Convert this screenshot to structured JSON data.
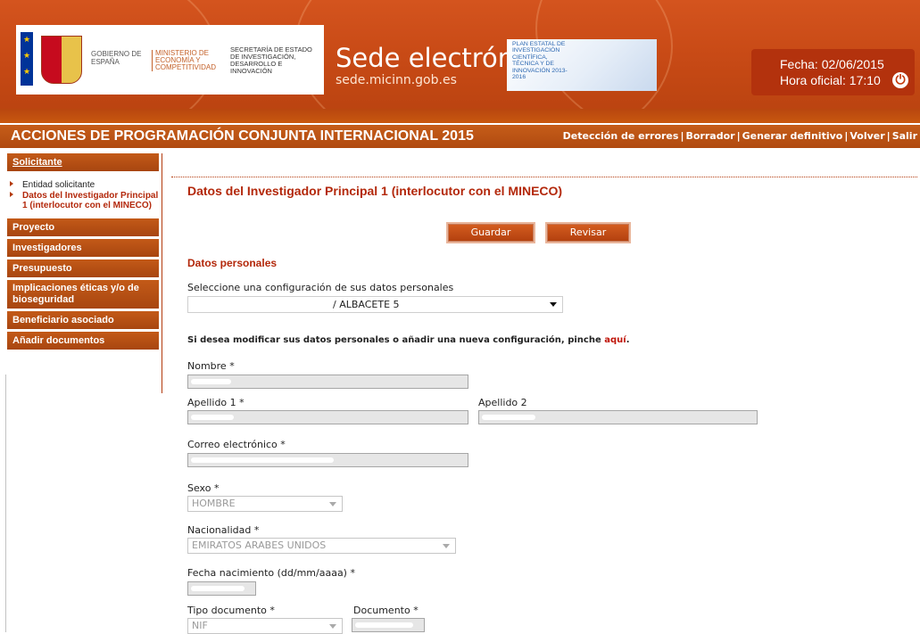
{
  "header": {
    "gobierno": "GOBIERNO DE ESPAÑA",
    "ministerio": "MINISTERIO DE ECONOMÍA Y COMPETITIVIDAD",
    "secretaria": "SECRETARÍA DE ESTADO DE INVESTIGACIÓN, DESARROLLO E INNOVACIÓN",
    "sede_title": "Sede electrónica",
    "sede_url": "sede.micinn.gob.es",
    "plan": "PLAN ESTATAL DE INVESTIGACIÓN CIENTÍFICA, TÉCNICA Y DE INNOVACIÓN 2013-2016",
    "fecha": "Fecha: 02/06/2015",
    "hora": "Hora oficial: 17:10",
    "power_icon": "power-icon"
  },
  "titlebar": {
    "title": "ACCIONES DE PROGRAMACIÓN CONJUNTA INTERNACIONAL 2015",
    "links": [
      "Detección de errores",
      "Borrador",
      "Generar definitivo",
      "Volver",
      "Salir"
    ]
  },
  "sidebar": {
    "head": "Solicitante",
    "subitems": [
      {
        "label": "Entidad solicitante",
        "active": false
      },
      {
        "label": "Datos del Investigador Principal 1 (interlocutor con el MINECO)",
        "active": true
      }
    ],
    "sections": [
      "Proyecto",
      "Investigadores",
      "Presupuesto",
      "Implicaciones éticas y/o de bioseguridad",
      "Beneficiario asociado",
      "Añadir documentos"
    ]
  },
  "main": {
    "title": "Datos del Investigador Principal 1 (interlocutor con el MINECO)",
    "guardar": "Guardar",
    "revisar": "Revisar",
    "section": "Datos personales",
    "config_label": "Seleccione una configuración de sus datos personales",
    "config_value": "/ ALBACETE 5",
    "info_text": "Si desea modificar sus datos personales o añadir una nueva configuración, pinche ",
    "info_link": "aquí",
    "info_end": ".",
    "nombre": "Nombre *",
    "apellido1": "Apellido 1 *",
    "apellido2": "Apellido 2",
    "correo": "Correo electrónico *",
    "sexo": "Sexo *",
    "sexo_value": "HOMBRE",
    "nacionalidad": "Nacionalidad *",
    "nacionalidad_value": "EMIRATOS ARABES UNIDOS",
    "fecha_nac": "Fecha nacimiento (dd/mm/aaaa) *",
    "tipo_doc": "Tipo documento *",
    "tipo_doc_value": "NIF",
    "documento": "Documento *"
  },
  "colors": {
    "header_orange": "#c84a16",
    "accent_red": "#b3280b"
  }
}
